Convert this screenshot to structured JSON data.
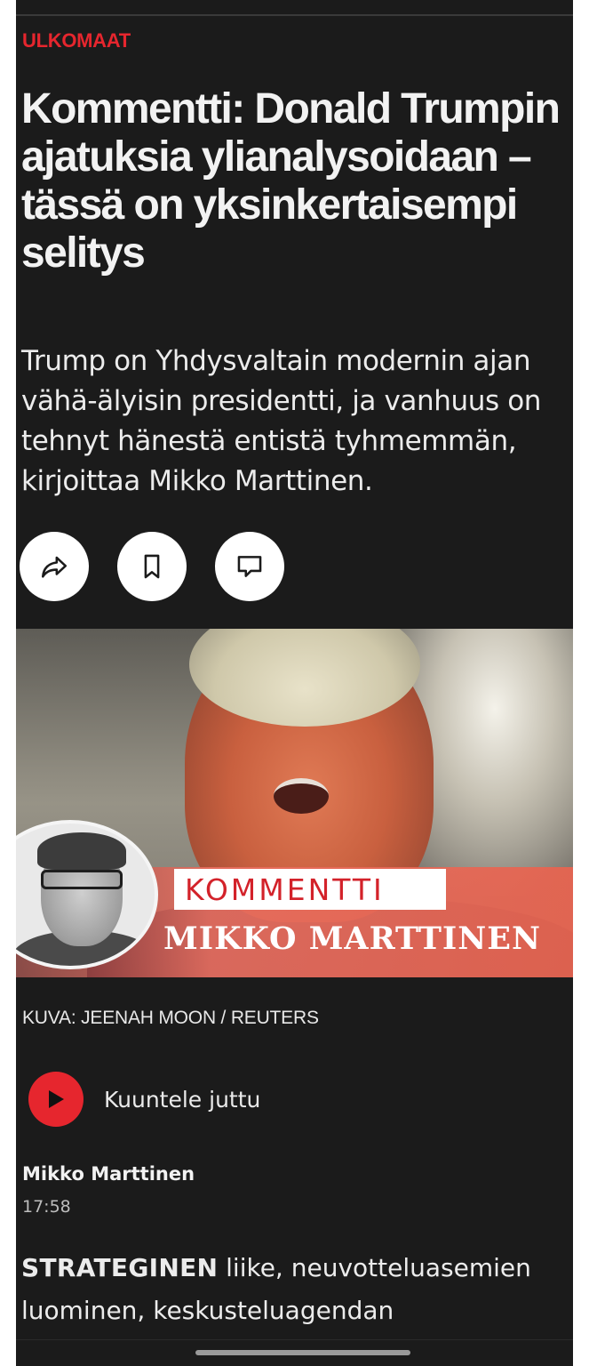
{
  "article": {
    "section": "ULKOMAAT",
    "headline": "Kommentti: Donald Trumpin ajatuksia ylianalysoidaan – tässä on yksinkertaisempi selitys",
    "lede": "Trump on Yhdysvaltain modernin ajan vähä-älyisin presidentti, ja vanhuus on tehnyt hänestä entistä tyhmemmän, kirjoittaa Mikko Marttinen.",
    "actions": [
      {
        "name": "share",
        "icon": "share-icon"
      },
      {
        "name": "bookmark",
        "icon": "bookmark-icon"
      },
      {
        "name": "comment",
        "icon": "comment-icon"
      }
    ],
    "hero": {
      "tag": "KOMMENTTI",
      "author_banner": "MIKKO MARTTINEN"
    },
    "caption": "KUVA: JEENAH MOON / REUTERS",
    "listen_label": "Kuuntele juttu",
    "author": "Mikko Marttinen",
    "time": "17:58",
    "body_lead": "STRATEGINEN",
    "body_rest": " liike, neuvotteluasemien luominen, keskusteluagendan"
  },
  "colors": {
    "accent": "#e6262e",
    "background": "#1b1b1b",
    "text": "#f2f2f2"
  }
}
